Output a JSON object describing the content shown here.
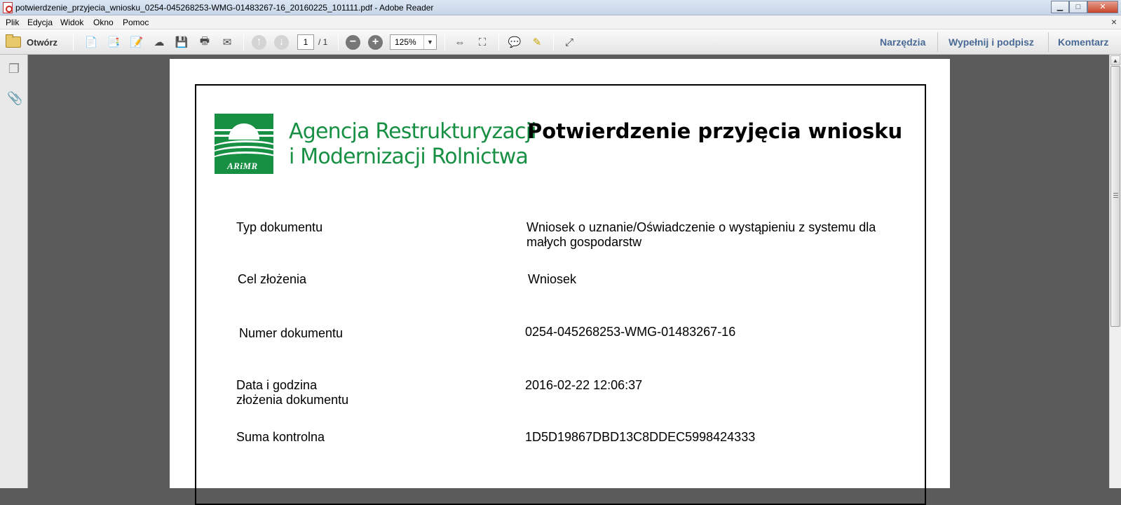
{
  "window": {
    "title": "potwierdzenie_przyjecia_wniosku_0254-045268253-WMG-01483267-16_20160225_101111.pdf - Adobe Reader",
    "controls": {
      "minimize": "▁",
      "maximize": "□",
      "close": "✕"
    }
  },
  "menu": {
    "items": [
      "Plik",
      "Edycja",
      "Widok",
      "Okno",
      "Pomoc"
    ],
    "doc_close": "×"
  },
  "toolbar": {
    "open_label": "Otwórz",
    "page_current": "1",
    "page_total": "/ 1",
    "zoom": "125%",
    "zoom_dropdown": "▼",
    "zoom_out": "−",
    "zoom_in": "+",
    "links": {
      "tools": "Narzędzia",
      "fill_sign": "Wypełnij i podpisz",
      "comment": "Komentarz"
    }
  },
  "document": {
    "logo_text": "ARiMR",
    "agency_line1": "Agencja Restrukturyzacji",
    "agency_line2": "i Modernizacji Rolnictwa",
    "title": "Potwierdzenie przyjęcia wniosku",
    "fields": [
      {
        "label": "Typ dokumentu",
        "value_line1": "Wniosek o uznanie/Oświadczenie o wystąpieniu z systemu dla",
        "value_line2": "małych gospodarstw"
      },
      {
        "label": "Cel złożenia",
        "value": "Wniosek"
      },
      {
        "label": "Numer dokumentu",
        "value": "0254-045268253-WMG-01483267-16"
      },
      {
        "label_line1": "Data i godzina",
        "label_line2": "złożenia dokumentu",
        "value": "2016-02-22 12:06:37"
      },
      {
        "label": "Suma kontrolna",
        "value": "1D5D19867DBD13C8DDEC5998424333"
      }
    ]
  },
  "colors": {
    "brand_green": "#179044",
    "link_blue": "#4a6a96"
  },
  "icons": {
    "page_thumbnails": "pages-icon",
    "attachments": "paperclip-icon"
  }
}
